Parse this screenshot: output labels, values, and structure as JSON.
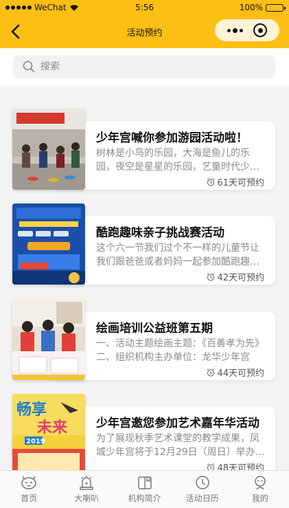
{
  "status_bar": {
    "carrier": "WeChat",
    "time": "5:56",
    "battery": "100%"
  },
  "nav": {
    "title": "活动预约",
    "back_icon": "chevron-left-icon"
  },
  "search": {
    "placeholder": "搜索"
  },
  "activities": [
    {
      "title": "少年宫喊你参加游园活动啦！",
      "description": "树林是小鸟的乐园，大海是鱼儿的乐园，夜空是星星的乐园，艺童时代少年宫是孩子们的乐园",
      "availability": "61天可预约"
    },
    {
      "title": "酷跑趣味亲子挑战赛活动",
      "description": "这个六一节我们过个不一样的儿童节让我们跟爸爸或者妈妈一起参加酷跑趣味亲子挑战赛",
      "availability": "42天可预约"
    },
    {
      "title": "绘画培训公益班第五期",
      "description": "一、活动主题绘画主题：《百善孝为先》二、组织机构主办单位：龙华少年宫",
      "availability": "44天可预约"
    },
    {
      "title": "少年宫邀您参加艺术嘉年华活动",
      "description": "为了展现秋季艺术课堂的教学成果，凤城少年宫将于12月29日（周日）举办艺术嘉年华",
      "availability": "48天可预约"
    }
  ],
  "thumb_text": {
    "fun": "畅享",
    "future": "未来",
    "year": "2019"
  },
  "tabbar": [
    {
      "label": "首页",
      "icon": "home-face-icon"
    },
    {
      "label": "大喇叭",
      "icon": "megaphone-icon"
    },
    {
      "label": "机构简介",
      "icon": "book-icon"
    },
    {
      "label": "活动日历",
      "icon": "clock-icon"
    },
    {
      "label": "我的",
      "icon": "user-icon"
    }
  ],
  "colors": {
    "accent": "#fdbf14",
    "card_bg": "#ffffff",
    "page_bg": "#f4f4f4",
    "muted_text": "#8a8a8a"
  }
}
